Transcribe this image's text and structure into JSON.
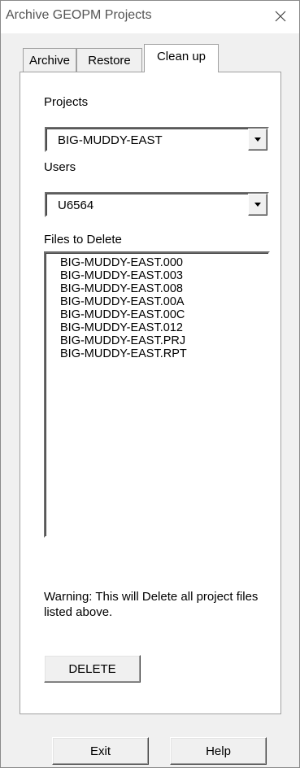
{
  "window": {
    "title": "Archive GEOPM Projects",
    "close_icon": "close-icon"
  },
  "tabs": [
    {
      "label": "Archive",
      "active": false
    },
    {
      "label": "Restore",
      "active": false
    },
    {
      "label": "Clean up",
      "active": true
    }
  ],
  "cleanup": {
    "projects_label": "Projects",
    "projects_value": "BIG-MUDDY-EAST",
    "users_label": "Users",
    "users_value": "U6564",
    "files_label": "Files to Delete",
    "files": [
      "BIG-MUDDY-EAST.000",
      "BIG-MUDDY-EAST.003",
      "BIG-MUDDY-EAST.008",
      "BIG-MUDDY-EAST.00A",
      "BIG-MUDDY-EAST.00C",
      "BIG-MUDDY-EAST.012",
      "BIG-MUDDY-EAST.PRJ",
      "BIG-MUDDY-EAST.RPT"
    ],
    "warning": "Warning: This will Delete all project files listed above.",
    "delete_label": "DELETE"
  },
  "footer": {
    "exit_label": "Exit",
    "help_label": "Help"
  }
}
